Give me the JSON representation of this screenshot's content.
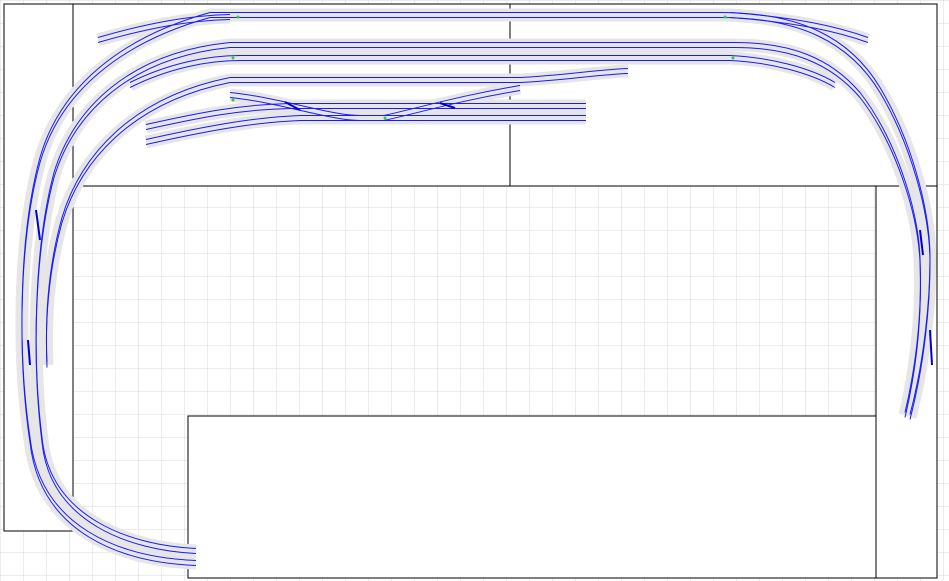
{
  "app": {
    "view": "track-plan-editor"
  },
  "colors": {
    "background": "#ffffff",
    "grid": "#d9d9d9",
    "baseboard_outline": "#000000",
    "track_bed": "#e6e6e6",
    "rail": "#1a1aff",
    "track_end_marker": "#33cc33"
  },
  "layers": {
    "grid": "on",
    "baseboards": "on",
    "tracks": "on"
  }
}
